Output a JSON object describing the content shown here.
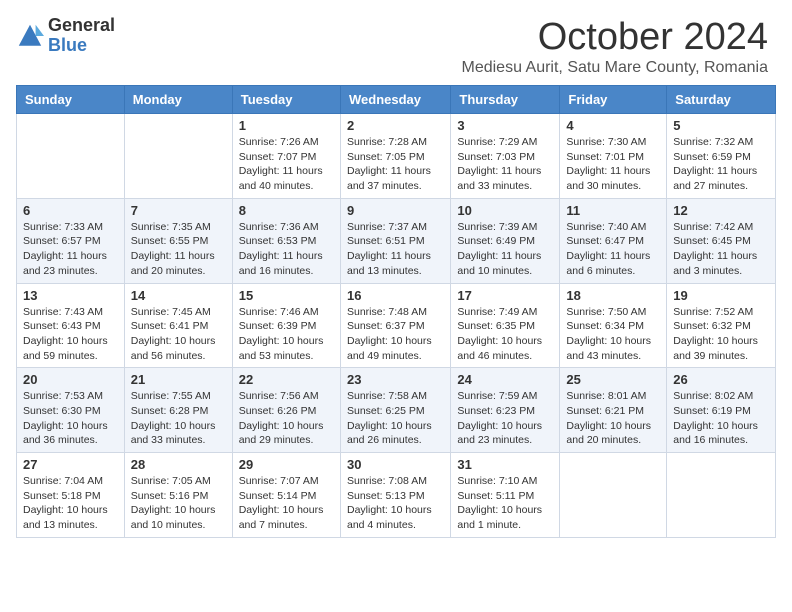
{
  "logo": {
    "general": "General",
    "blue": "Blue"
  },
  "header": {
    "month": "October 2024",
    "location": "Mediesu Aurit, Satu Mare County, Romania"
  },
  "weekdays": [
    "Sunday",
    "Monday",
    "Tuesday",
    "Wednesday",
    "Thursday",
    "Friday",
    "Saturday"
  ],
  "weeks": [
    [
      {
        "day": "",
        "info": ""
      },
      {
        "day": "",
        "info": ""
      },
      {
        "day": "1",
        "info": "Sunrise: 7:26 AM\nSunset: 7:07 PM\nDaylight: 11 hours and 40 minutes."
      },
      {
        "day": "2",
        "info": "Sunrise: 7:28 AM\nSunset: 7:05 PM\nDaylight: 11 hours and 37 minutes."
      },
      {
        "day": "3",
        "info": "Sunrise: 7:29 AM\nSunset: 7:03 PM\nDaylight: 11 hours and 33 minutes."
      },
      {
        "day": "4",
        "info": "Sunrise: 7:30 AM\nSunset: 7:01 PM\nDaylight: 11 hours and 30 minutes."
      },
      {
        "day": "5",
        "info": "Sunrise: 7:32 AM\nSunset: 6:59 PM\nDaylight: 11 hours and 27 minutes."
      }
    ],
    [
      {
        "day": "6",
        "info": "Sunrise: 7:33 AM\nSunset: 6:57 PM\nDaylight: 11 hours and 23 minutes."
      },
      {
        "day": "7",
        "info": "Sunrise: 7:35 AM\nSunset: 6:55 PM\nDaylight: 11 hours and 20 minutes."
      },
      {
        "day": "8",
        "info": "Sunrise: 7:36 AM\nSunset: 6:53 PM\nDaylight: 11 hours and 16 minutes."
      },
      {
        "day": "9",
        "info": "Sunrise: 7:37 AM\nSunset: 6:51 PM\nDaylight: 11 hours and 13 minutes."
      },
      {
        "day": "10",
        "info": "Sunrise: 7:39 AM\nSunset: 6:49 PM\nDaylight: 11 hours and 10 minutes."
      },
      {
        "day": "11",
        "info": "Sunrise: 7:40 AM\nSunset: 6:47 PM\nDaylight: 11 hours and 6 minutes."
      },
      {
        "day": "12",
        "info": "Sunrise: 7:42 AM\nSunset: 6:45 PM\nDaylight: 11 hours and 3 minutes."
      }
    ],
    [
      {
        "day": "13",
        "info": "Sunrise: 7:43 AM\nSunset: 6:43 PM\nDaylight: 10 hours and 59 minutes."
      },
      {
        "day": "14",
        "info": "Sunrise: 7:45 AM\nSunset: 6:41 PM\nDaylight: 10 hours and 56 minutes."
      },
      {
        "day": "15",
        "info": "Sunrise: 7:46 AM\nSunset: 6:39 PM\nDaylight: 10 hours and 53 minutes."
      },
      {
        "day": "16",
        "info": "Sunrise: 7:48 AM\nSunset: 6:37 PM\nDaylight: 10 hours and 49 minutes."
      },
      {
        "day": "17",
        "info": "Sunrise: 7:49 AM\nSunset: 6:35 PM\nDaylight: 10 hours and 46 minutes."
      },
      {
        "day": "18",
        "info": "Sunrise: 7:50 AM\nSunset: 6:34 PM\nDaylight: 10 hours and 43 minutes."
      },
      {
        "day": "19",
        "info": "Sunrise: 7:52 AM\nSunset: 6:32 PM\nDaylight: 10 hours and 39 minutes."
      }
    ],
    [
      {
        "day": "20",
        "info": "Sunrise: 7:53 AM\nSunset: 6:30 PM\nDaylight: 10 hours and 36 minutes."
      },
      {
        "day": "21",
        "info": "Sunrise: 7:55 AM\nSunset: 6:28 PM\nDaylight: 10 hours and 33 minutes."
      },
      {
        "day": "22",
        "info": "Sunrise: 7:56 AM\nSunset: 6:26 PM\nDaylight: 10 hours and 29 minutes."
      },
      {
        "day": "23",
        "info": "Sunrise: 7:58 AM\nSunset: 6:25 PM\nDaylight: 10 hours and 26 minutes."
      },
      {
        "day": "24",
        "info": "Sunrise: 7:59 AM\nSunset: 6:23 PM\nDaylight: 10 hours and 23 minutes."
      },
      {
        "day": "25",
        "info": "Sunrise: 8:01 AM\nSunset: 6:21 PM\nDaylight: 10 hours and 20 minutes."
      },
      {
        "day": "26",
        "info": "Sunrise: 8:02 AM\nSunset: 6:19 PM\nDaylight: 10 hours and 16 minutes."
      }
    ],
    [
      {
        "day": "27",
        "info": "Sunrise: 7:04 AM\nSunset: 5:18 PM\nDaylight: 10 hours and 13 minutes."
      },
      {
        "day": "28",
        "info": "Sunrise: 7:05 AM\nSunset: 5:16 PM\nDaylight: 10 hours and 10 minutes."
      },
      {
        "day": "29",
        "info": "Sunrise: 7:07 AM\nSunset: 5:14 PM\nDaylight: 10 hours and 7 minutes."
      },
      {
        "day": "30",
        "info": "Sunrise: 7:08 AM\nSunset: 5:13 PM\nDaylight: 10 hours and 4 minutes."
      },
      {
        "day": "31",
        "info": "Sunrise: 7:10 AM\nSunset: 5:11 PM\nDaylight: 10 hours and 1 minute."
      },
      {
        "day": "",
        "info": ""
      },
      {
        "day": "",
        "info": ""
      }
    ]
  ]
}
